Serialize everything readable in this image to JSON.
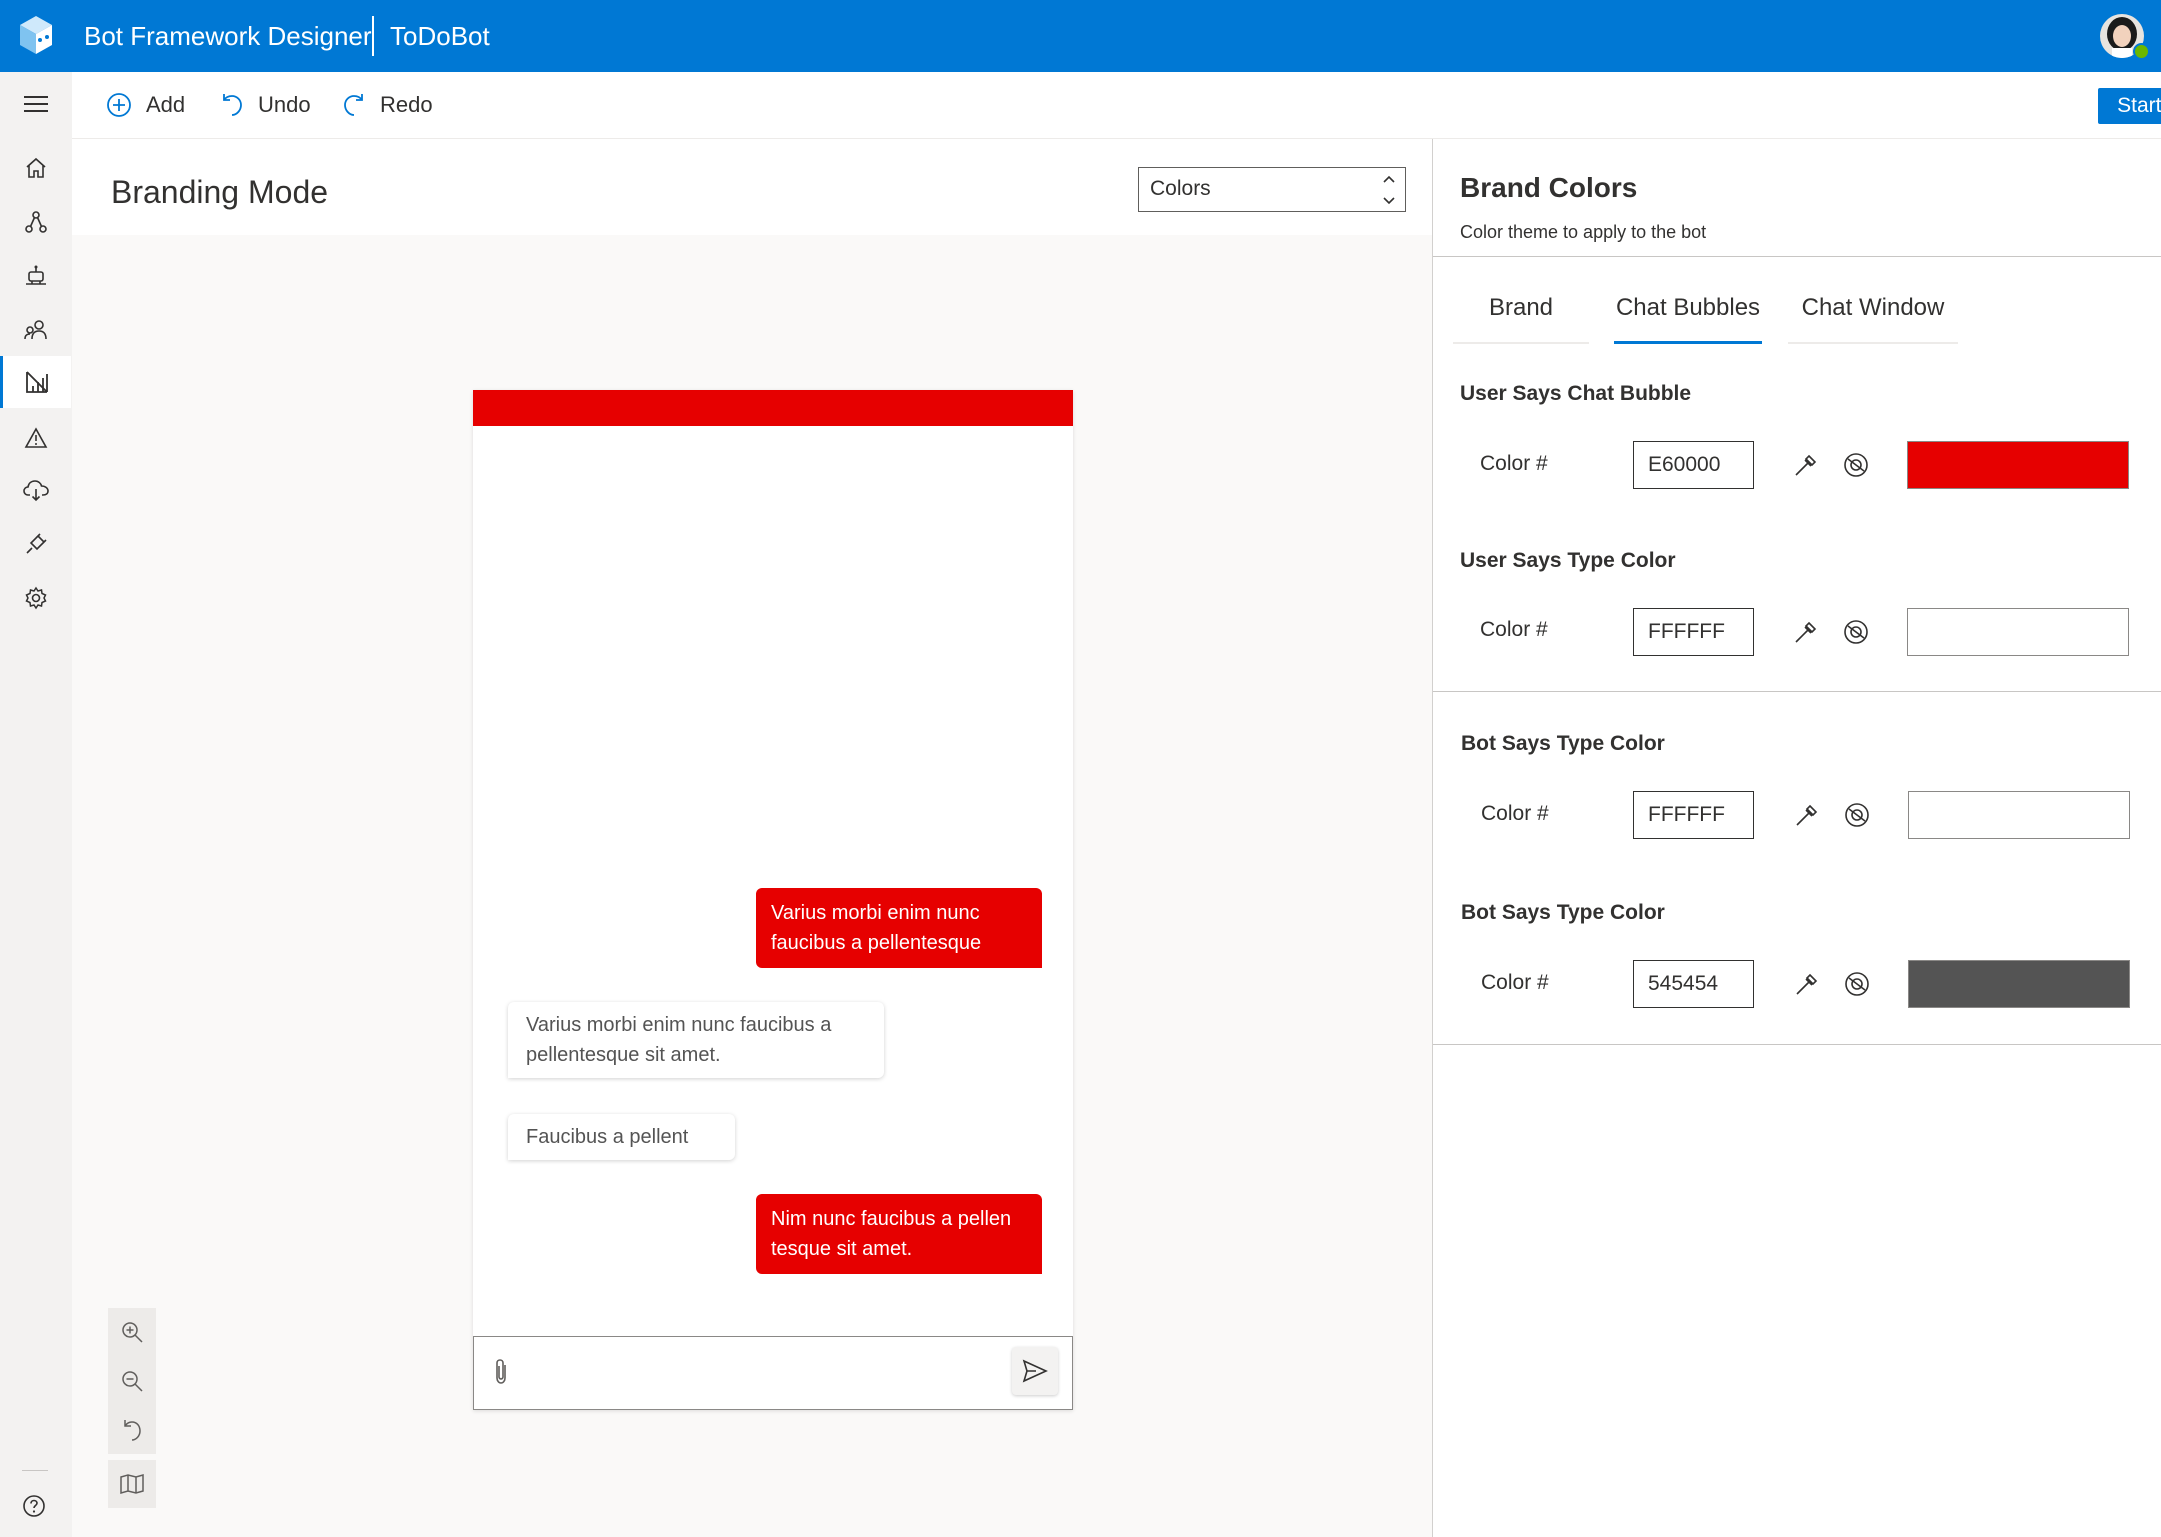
{
  "header": {
    "app_title": "Bot Framework Designer",
    "project_name": "ToDoBot"
  },
  "commands": {
    "add": "Add",
    "undo": "Undo",
    "redo": "Redo",
    "start_bot": "Start Bot"
  },
  "nav": {
    "items": [
      {
        "icon": "home-icon"
      },
      {
        "icon": "dialogs-icon"
      },
      {
        "icon": "bot-icon"
      },
      {
        "icon": "users-icon"
      },
      {
        "icon": "branding-icon",
        "active": true
      },
      {
        "icon": "warning-icon"
      },
      {
        "icon": "cloud-publish-icon"
      },
      {
        "icon": "plugin-icon"
      },
      {
        "icon": "gear-icon"
      }
    ],
    "help_icon": "help-icon"
  },
  "main": {
    "title": "Branding Mode",
    "mode_select": {
      "selected": "Colors"
    }
  },
  "chat": {
    "messages": [
      {
        "from": "user",
        "text": "Varius morbi enim nunc faucibus a pellentesque"
      },
      {
        "from": "bot",
        "text": "Varius morbi enim nunc faucibus a pellentesque sit amet."
      },
      {
        "from": "bot",
        "text": "Faucibus a pellent"
      },
      {
        "from": "user",
        "text": "Nim nunc faucibus a pellen tesque sit amet."
      }
    ]
  },
  "panel": {
    "title": "Brand Colors",
    "subtitle": "Color theme to apply to the bot",
    "tabs": [
      {
        "label": "Brand",
        "active": false
      },
      {
        "label": "Chat Bubbles",
        "active": true
      },
      {
        "label": "Chat Window",
        "active": false
      }
    ],
    "color_label": "Color #",
    "sections": [
      {
        "title": "User Says Chat Bubble",
        "hex": "E60000",
        "color": "#e60000"
      },
      {
        "title": "User Says Type Color",
        "hex": "FFFFFF",
        "color": "#ffffff"
      },
      {
        "title": "Bot Says Type Color",
        "hex": "FFFFFF",
        "color": "#ffffff"
      },
      {
        "title": "Bot Says Type Color",
        "hex": "545454",
        "color": "#545454"
      }
    ]
  },
  "colors": {
    "accent": "#0078d4",
    "brand_red": "#e60000",
    "bot_text": "#545454"
  }
}
